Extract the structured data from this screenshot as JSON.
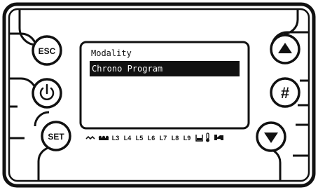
{
  "display": {
    "lines": [
      {
        "text": "Modality",
        "selected": false
      },
      {
        "text": "Chrono Program",
        "selected": true
      }
    ]
  },
  "buttons": {
    "esc": "ESC",
    "set": "SET",
    "up": "up-arrow-icon",
    "down": "down-arrow-icon",
    "hash": "#",
    "power": "power-icon"
  },
  "indicators": {
    "labels": [
      "L3",
      "L4",
      "L5",
      "L6",
      "L7",
      "L8",
      "L9"
    ],
    "icons": [
      "resistance-icon",
      "fan-icon",
      "tank-icon",
      "thermometer-icon",
      "pump-icon"
    ]
  },
  "colors": {
    "frame": "#111111",
    "background": "#ffffff"
  }
}
